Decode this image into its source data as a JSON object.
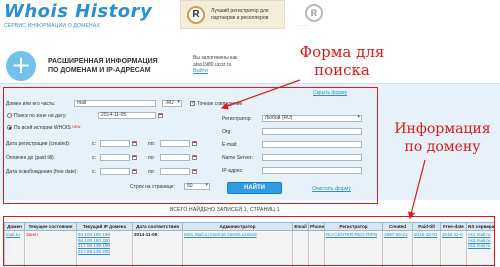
{
  "header": {
    "logo_text": "Whois History",
    "logo_subtitle": "СЕРВИС ИНФОРМАЦИИ О ДОМЕНАХ",
    "ad_text_1": "Лучший регистратор для",
    "ad_text_2": "партнеров и реселлеров",
    "ad_logo_glyph": "R",
    "ad_logo2_glyph": "R"
  },
  "info": {
    "plus_glyph": "+",
    "title_line_1": "РАСШИРЕННАЯ ИНФОРМАЦИЯ",
    "title_line_2": "ПО ДОМЕНАМ И IP-АДРЕСАМ",
    "login_line_1": "Вы залогинены как",
    "login_user": "atas1980.ucoz.ru",
    "logout": "Выйти"
  },
  "annotations": {
    "form_note_1": "Форма для поиска",
    "form_note_2": "домена",
    "info_note_1": "Информация",
    "info_note_2": "по домену"
  },
  "form": {
    "hide_form": "Скрыть форму",
    "domain_label": "Домен или его часть:",
    "domain_value": "mail",
    "zone_value": ".RU",
    "exact_match": "Точное совпадение",
    "zone_by_date": "Поиск по зоне на дату:",
    "zone_date_value": "2014-11-05",
    "whois_history": "По всей истории WHOIS",
    "whois_history_badge": "NEW",
    "registrar_label": "Регистратор:",
    "registrar_value": "Любой (RU)",
    "reg_date_label": "Дата регистрации (created):",
    "paid_label": "Оплачен до (paid till):",
    "free_label": "Дата освобождения (free date):",
    "from": "с:",
    "to": "по:",
    "org_label": "Org:",
    "email_label": "E-mail:",
    "ns_label": "Name Server:",
    "ip_label": "IP-адрес:",
    "rows_label": "Строк на странице:",
    "rows_value": "50",
    "find_button": "НАЙТИ",
    "clear_form": "Очистить форму"
  },
  "results": {
    "count_text": "ВСЕГО НАЙДЕНО ЗАПИСЕЙ 1, СТРАНИЦ 1",
    "columns": [
      "Домен",
      "Текущее состояние",
      "Текущий IP домена",
      "Дата соответствия",
      "Администратор",
      "Email",
      "Phone",
      "Регистратор",
      "Created",
      "Paid-till",
      "Free-date",
      "NS сервера"
    ],
    "rows": [
      {
        "domain": "mail.ru",
        "state": "Занят",
        "ips": [
          "94.100.180.199",
          "94.100.180.200",
          "217.69.139.199",
          "217.69.139.200"
        ],
        "date": "2014-11-05",
        "admin": "MGL Mail.ru Internet Assets Limited",
        "email": "",
        "phone": "",
        "registrar": "RU-CENTER-REG-RIPN",
        "created": "1997-09-21",
        "paid_till": "2015-10-01",
        "free_date": "2015-11-0",
        "ns": [
          "ns1.mail.ru",
          "ns2.mail.ru",
          "ns3.mail.ru"
        ]
      }
    ]
  },
  "colors": {
    "accent": "#2b8fd6",
    "annotation": "#e01818",
    "panel": "#e6f1f9"
  }
}
